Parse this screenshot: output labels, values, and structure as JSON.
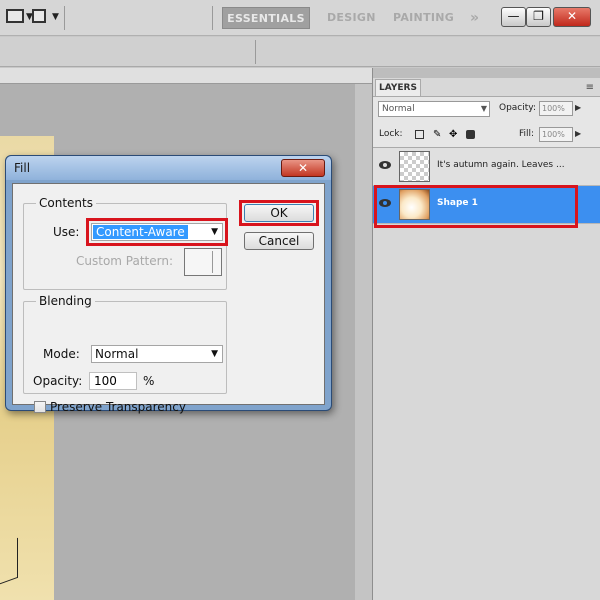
{
  "workspace": {
    "essentials": "ESSENTIALS",
    "design": "DESIGN",
    "painting": "PAINTING",
    "more": "»"
  },
  "window_controls": {
    "minimize": "—",
    "maximize": "❐",
    "close": "✕"
  },
  "fill_dialog": {
    "title": "Fill",
    "close_glyph": "✕",
    "contents_legend": "Contents",
    "use_label": "Use:",
    "use_value": "Content-Aware",
    "custom_pattern_label": "Custom Pattern:",
    "blending_legend": "Blending",
    "mode_label": "Mode:",
    "mode_value": "Normal",
    "opacity_label": "Opacity:",
    "opacity_value": "100",
    "opacity_unit": "%",
    "preserve_transparency_label": "Preserve Transparency",
    "preserve_transparency_checked": false,
    "ok_label": "OK",
    "cancel_label": "Cancel"
  },
  "layers_panel": {
    "tab_label": "LAYERS",
    "blend_mode": "Normal",
    "opacity_label": "Opacity:",
    "opacity_value": "100%",
    "lock_label": "Lock:",
    "fill_label": "Fill:",
    "fill_value": "100%",
    "layers": [
      {
        "name": "It's autumn again. Leaves ...",
        "selected": false
      },
      {
        "name": "Shape 1",
        "selected": true
      }
    ]
  },
  "colors": {
    "selection_blue": "#3c8ff0",
    "highlight_red": "#d8141d",
    "dialog_frame": "#7fa3cc"
  }
}
